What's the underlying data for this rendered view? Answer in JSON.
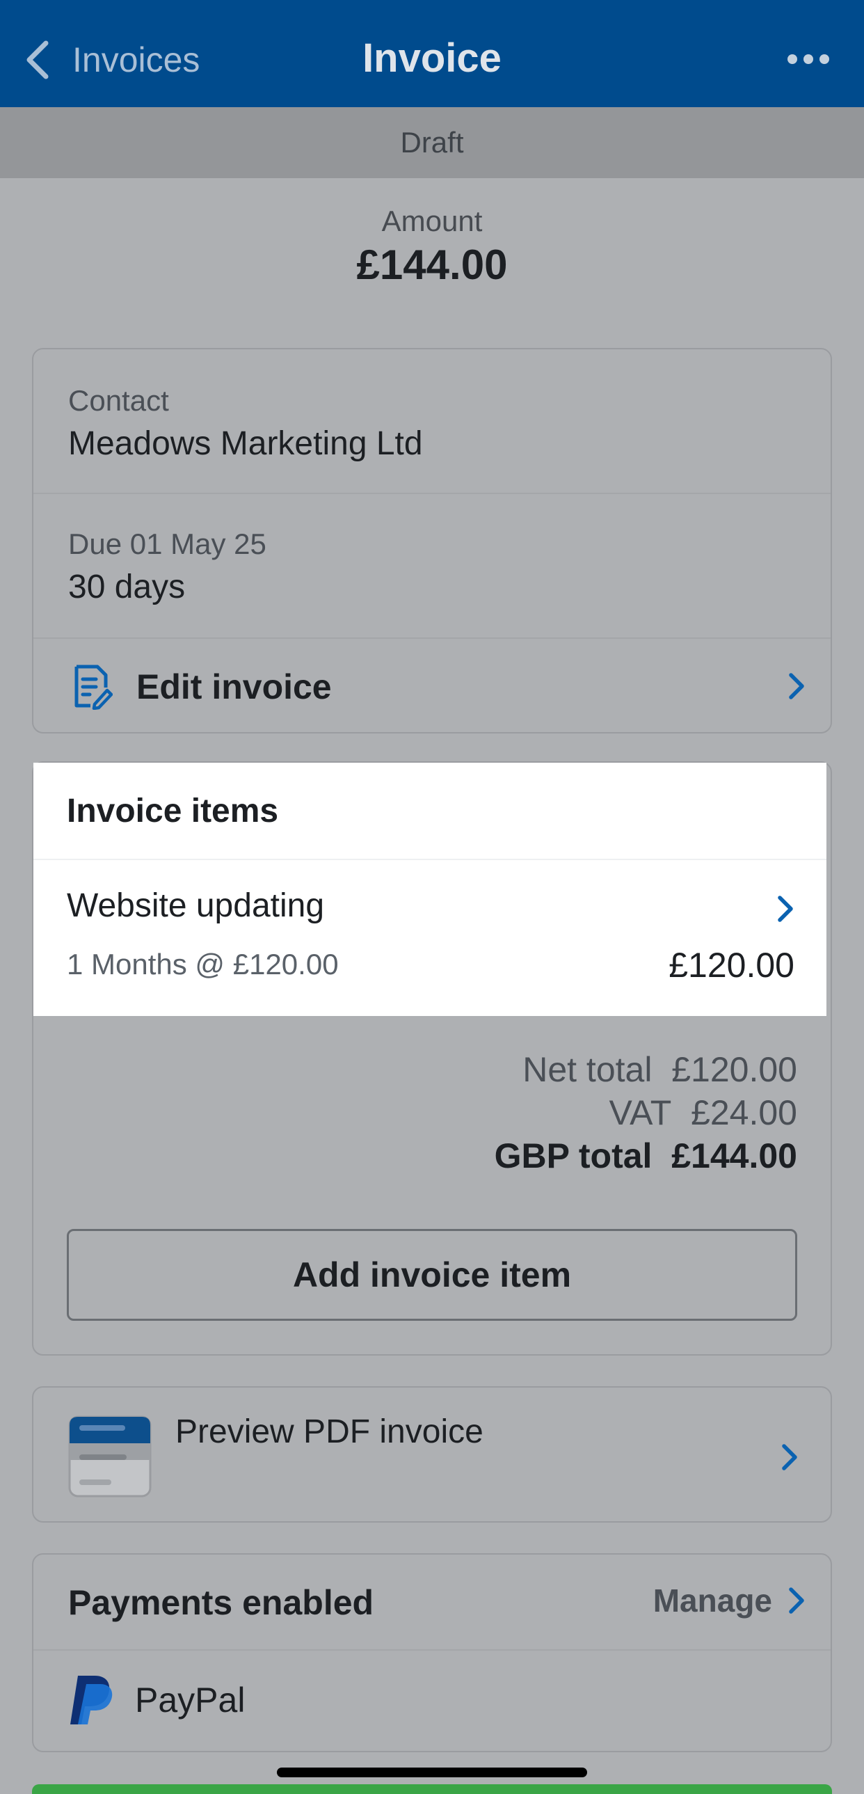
{
  "nav": {
    "back_label": "Invoices",
    "title": "Invoice"
  },
  "status": "Draft",
  "amount": {
    "label": "Amount",
    "value": "£144.00"
  },
  "details": {
    "contact_label": "Contact",
    "contact_value": "Meadows Marketing Ltd",
    "due_label": "Due 01 May 25",
    "due_value": "30 days",
    "edit_label": "Edit invoice"
  },
  "items": {
    "title": "Invoice items",
    "list": [
      {
        "description": "Website updating",
        "detail": "1 Months @ £120.00",
        "amount": "£120.00"
      }
    ]
  },
  "totals": {
    "net_label": "Net total",
    "net_value": "£120.00",
    "vat_label": "VAT",
    "vat_value": "£24.00",
    "gbp_label": "GBP total",
    "gbp_value": "£144.00"
  },
  "add_item_label": "Add invoice item",
  "preview_label": "Preview PDF invoice",
  "payments": {
    "title": "Payments enabled",
    "manage_label": "Manage",
    "provider": "PayPal"
  },
  "colors": {
    "nav": "#004b8d",
    "accent": "#0b62b0",
    "background": "#aeb0b3",
    "success": "#3aa546"
  }
}
